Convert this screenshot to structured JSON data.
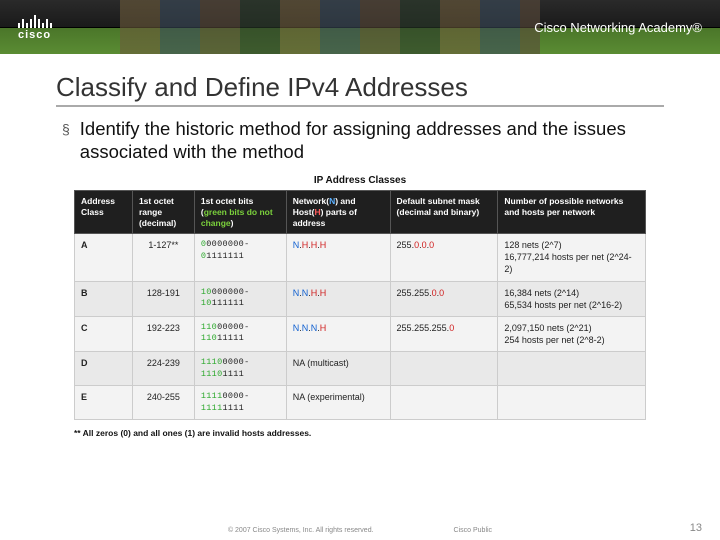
{
  "header": {
    "brand": "cisco",
    "academy": "Cisco Networking Academy®"
  },
  "title": "Classify and Define IPv4 Addresses",
  "bullet": "Identify the historic method for assigning addresses and the issues associated with the method",
  "figure": {
    "title": "IP Address Classes",
    "headers": {
      "cls": "Address Class",
      "range": "1st octet range (decimal)",
      "bits_pre": "1st octet bits (",
      "bits_green": "green bits do not change",
      "bits_post": ")",
      "nh_pre": "Network(",
      "nh_n": "N",
      "nh_mid": ") and Host(",
      "nh_h": "H",
      "nh_post": ") parts of address",
      "mask": "Default subnet mask (decimal and binary)",
      "count": "Number of possible networks and hosts per network"
    },
    "rows": [
      {
        "cls": "A",
        "range": "1-127**",
        "bits_a": "0",
        "bits_b": "0000000-",
        "bits_c": "0",
        "bits_d": "1111111",
        "nh": "N.H.H.H",
        "mask": "255.0.0.0",
        "count": "128 nets (2^7)\n16,777,214 hosts per net (2^24-2)"
      },
      {
        "cls": "B",
        "range": "128-191",
        "bits_a": "10",
        "bits_b": "000000-",
        "bits_c": "10",
        "bits_d": "111111",
        "nh": "N.N.H.H",
        "mask": "255.255.0.0",
        "count": "16,384 nets (2^14)\n65,534 hosts per net (2^16-2)"
      },
      {
        "cls": "C",
        "range": "192-223",
        "bits_a": "110",
        "bits_b": "00000-",
        "bits_c": "110",
        "bits_d": "11111",
        "nh": "N.N.N.H",
        "mask": "255.255.255.0",
        "count": "2,097,150 nets (2^21)\n254 hosts per net (2^8-2)"
      },
      {
        "cls": "D",
        "range": "224-239",
        "bits_a": "1110",
        "bits_b": "0000-",
        "bits_c": "1110",
        "bits_d": "1111",
        "nh": "NA (multicast)",
        "mask": "",
        "count": ""
      },
      {
        "cls": "E",
        "range": "240-255",
        "bits_a": "1111",
        "bits_b": "0000-",
        "bits_c": "1111",
        "bits_d": "1111",
        "nh": "NA (experimental)",
        "mask": "",
        "count": ""
      }
    ],
    "footnote": "** All zeros (0) and all ones (1) are invalid hosts addresses."
  },
  "footer": {
    "copyright": "© 2007 Cisco Systems, Inc. All rights reserved.",
    "label": "Cisco Public",
    "page": "13"
  },
  "chart_data": {
    "type": "table",
    "title": "IP Address Classes",
    "columns": [
      "Address Class",
      "1st octet range (decimal)",
      "1st octet bits (green bits do not change)",
      "Network(N) and Host(H) parts of address",
      "Default subnet mask (decimal and binary)",
      "Number of possible networks and hosts per network"
    ],
    "rows": [
      [
        "A",
        "1-127**",
        "00000000-01111111",
        "N.H.H.H",
        "255.0.0.0",
        "128 nets (2^7); 16,777,214 hosts per net (2^24-2)"
      ],
      [
        "B",
        "128-191",
        "10000000-10111111",
        "N.N.H.H",
        "255.255.0.0",
        "16,384 nets (2^14); 65,534 hosts per net (2^16-2)"
      ],
      [
        "C",
        "192-223",
        "11000000-11011111",
        "N.N.N.H",
        "255.255.255.0",
        "2,097,150 nets (2^21); 254 hosts per net (2^8-2)"
      ],
      [
        "D",
        "224-239",
        "11100000-11101111",
        "NA (multicast)",
        "",
        ""
      ],
      [
        "E",
        "240-255",
        "11110000-11111111",
        "NA (experimental)",
        "",
        ""
      ]
    ],
    "footnote": "** All zeros (0) and all ones (1) are invalid hosts addresses."
  }
}
